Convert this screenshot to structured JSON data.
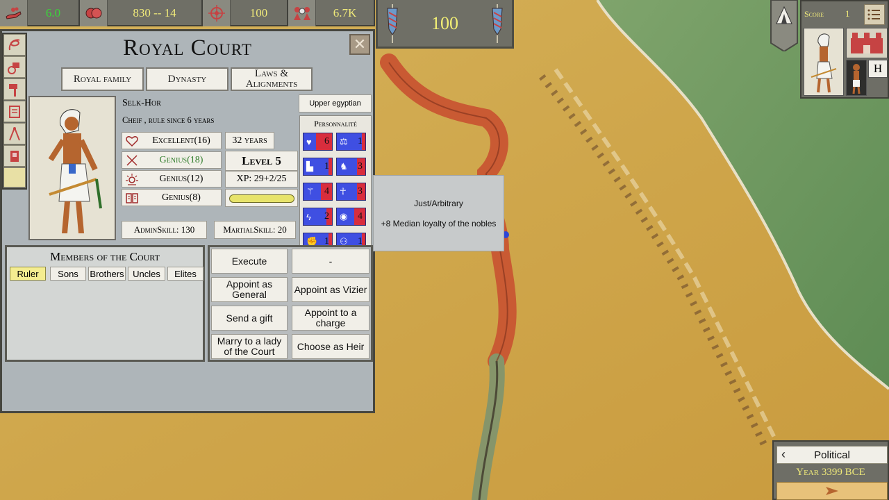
{
  "resources": {
    "food": "6.0",
    "population": "830 -- 14",
    "military": "100",
    "prestige": "6.7K"
  },
  "banner": {
    "value": "100"
  },
  "court": {
    "title": "Royal Court",
    "tabs": [
      "Royal family",
      "Dynasty",
      "Laws & Alignments"
    ],
    "character": {
      "name": "Selk-Hor",
      "title": "Cheif , rule since 6 years",
      "culture": "Upper egyptian",
      "stats": [
        {
          "icon": "heart-icon",
          "label": "Excellent(16)",
          "color": "#222222"
        },
        {
          "icon": "crossed-swords-icon",
          "label": "Genius(18)",
          "color": "#2f7d2a"
        },
        {
          "icon": "sun-icon",
          "label": "Genius(12)",
          "color": "#222222"
        },
        {
          "icon": "book-icon",
          "label": "Genius(8)",
          "color": "#222222"
        }
      ],
      "age": "32 years",
      "level": "Level 5",
      "xp": "XP: 29+2/25",
      "xp_fraction": 1.0,
      "admin_skill": "AdminSkill: 130",
      "martial_skill": "MartialSkill: 20"
    },
    "personality": {
      "title": "Personnalité",
      "traits": [
        {
          "icon": "heart-icon",
          "value": "6",
          "red": 0.55
        },
        {
          "icon": "scales-icon",
          "value": "1",
          "red": 0.12
        },
        {
          "icon": "chair-icon",
          "value": "1",
          "red": 0.12
        },
        {
          "icon": "elephant-icon",
          "value": "3",
          "red": 0.3
        },
        {
          "icon": "scepter-icon",
          "value": "4",
          "red": 0.4
        },
        {
          "icon": "ankh-icon",
          "value": "3",
          "red": 0.3
        },
        {
          "icon": "lightning-icon",
          "value": "2",
          "red": 0.2
        },
        {
          "icon": "eye-icon",
          "value": "4",
          "red": 0.4
        },
        {
          "icon": "fist-icon",
          "value": "1",
          "red": 0.12
        },
        {
          "icon": "people-icon",
          "value": "1",
          "red": 0.12
        }
      ]
    },
    "tooltip": {
      "title": "Just/Arbitrary",
      "desc": "+8 Median loyalty of the nobles"
    },
    "members": {
      "title": "Members of the Court",
      "tabs": [
        "Ruler",
        "Sons",
        "Brothers",
        "Uncles",
        "Elites"
      ],
      "selected": "Ruler"
    },
    "actions": [
      "Execute",
      "-",
      "Appoint as General",
      "Appoint as Vizier",
      "Send a gift",
      "Appoint to a charge",
      "Marry to a lady of the Court",
      "Choose as Heir"
    ]
  },
  "score": {
    "label": "Score",
    "value": "1",
    "h_label": "H"
  },
  "bottom": {
    "political": "Political",
    "year": "Year 3399 BCE"
  },
  "colors": {
    "accent_yellow": "#f0ea7a",
    "green_value": "#39d639",
    "trait_blue": "#3f4fe2",
    "trait_red": "#d82d3d"
  }
}
